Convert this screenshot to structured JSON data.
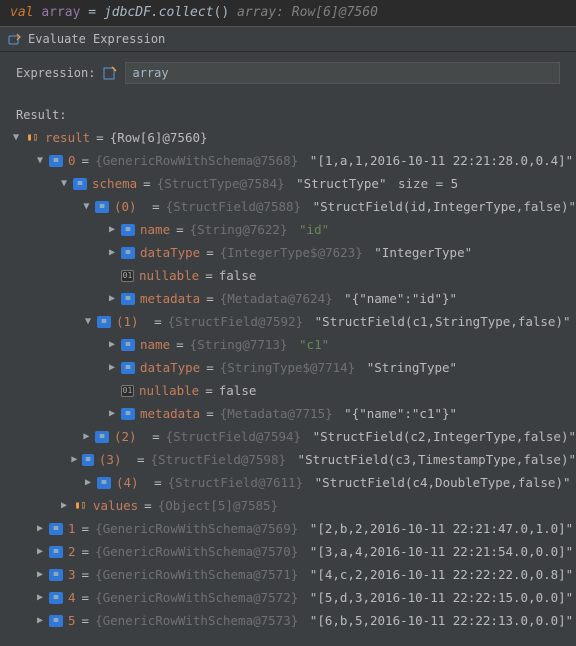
{
  "code": {
    "keyword": "val",
    "varname": "array",
    "assign": " = jdbcDF.",
    "method": "collect",
    "parens": "()",
    "comment": "   array: Row[6]@7560"
  },
  "titlebar": {
    "text": "Evaluate Expression"
  },
  "expression": {
    "label": "Expression:",
    "value": "array"
  },
  "resultLabel": "Result:",
  "tree": {
    "root": {
      "name": "result",
      "val": "{Row[6]@7560}"
    },
    "item0": {
      "idx": "0",
      "type": "{GenericRowWithSchema@7568}",
      "str": "\"[1,a,1,2016-10-11 22:21:28.0,0.4]\""
    },
    "schema": {
      "name": "schema",
      "type": "{StructType@7584}",
      "str": "\"StructType\"",
      "size": "size = 5"
    },
    "f0": {
      "idx": "(0)",
      "type": "{StructField@7588}",
      "str": "\"StructField(id,IntegerType,false)\""
    },
    "f0name": {
      "name": "name",
      "type": "{String@7622}",
      "str": "\"id\""
    },
    "f0dt": {
      "name": "dataType",
      "type": "{IntegerType$@7623}",
      "str": "\"IntegerType\""
    },
    "f0null": {
      "name": "nullable",
      "val": "false"
    },
    "f0meta": {
      "name": "metadata",
      "type": "{Metadata@7624}",
      "str": "\"{\"name\":\"id\"}\""
    },
    "f1": {
      "idx": "(1)",
      "type": "{StructField@7592}",
      "str": "\"StructField(c1,StringType,false)\""
    },
    "f1name": {
      "name": "name",
      "type": "{String@7713}",
      "str": "\"c1\""
    },
    "f1dt": {
      "name": "dataType",
      "type": "{StringType$@7714}",
      "str": "\"StringType\""
    },
    "f1null": {
      "name": "nullable",
      "val": "false"
    },
    "f1meta": {
      "name": "metadata",
      "type": "{Metadata@7715}",
      "str": "\"{\"name\":\"c1\"}\""
    },
    "f2": {
      "idx": "(2)",
      "type": "{StructField@7594}",
      "str": "\"StructField(c2,IntegerType,false)\""
    },
    "f3": {
      "idx": "(3)",
      "type": "{StructField@7598}",
      "str": "\"StructField(c3,TimestampType,false)\""
    },
    "f4": {
      "idx": "(4)",
      "type": "{StructField@7611}",
      "str": "\"StructField(c4,DoubleType,false)\""
    },
    "values": {
      "name": "values",
      "type": "{Object[5]@7585}"
    },
    "item1": {
      "idx": "1",
      "type": "{GenericRowWithSchema@7569}",
      "str": "\"[2,b,2,2016-10-11 22:21:47.0,1.0]\""
    },
    "item2": {
      "idx": "2",
      "type": "{GenericRowWithSchema@7570}",
      "str": "\"[3,a,4,2016-10-11 22:21:54.0,0.0]\""
    },
    "item3": {
      "idx": "3",
      "type": "{GenericRowWithSchema@7571}",
      "str": "\"[4,c,2,2016-10-11 22:22:22.0,0.8]\""
    },
    "item4": {
      "idx": "4",
      "type": "{GenericRowWithSchema@7572}",
      "str": "\"[5,d,3,2016-10-11 22:22:15.0,0.0]\""
    },
    "item5": {
      "idx": "5",
      "type": "{GenericRowWithSchema@7573}",
      "str": "\"[6,b,5,2016-10-11 22:22:13.0,0.0]\""
    }
  }
}
